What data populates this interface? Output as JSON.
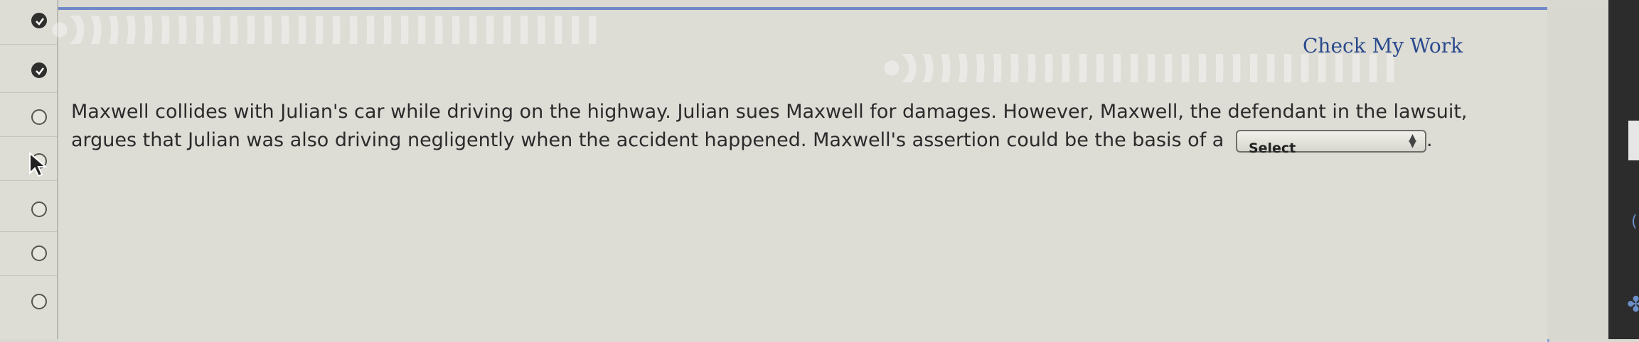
{
  "header": {
    "check_work_label": "Check My Work"
  },
  "question": {
    "text_line_1": "Maxwell collides with Julian's car while driving on the highway. Julian sues Maxwell for damages. However, Maxwell, the defendant in the lawsuit,",
    "text_line_2_before": "argues that Julian was also driving negligently when the accident happened. Maxwell's assertion could be the basis of a",
    "select_value": "Select",
    "text_after": "."
  },
  "nav": {
    "items": [
      {
        "status": "completed",
        "icon": "check-circle-icon"
      },
      {
        "status": "completed",
        "icon": "check-circle-icon"
      },
      {
        "status": "unanswered",
        "icon": "empty-circle-icon"
      },
      {
        "status": "current",
        "icon": "empty-circle-icon"
      },
      {
        "status": "unanswered",
        "icon": "empty-circle-icon"
      },
      {
        "status": "unanswered",
        "icon": "empty-circle-icon"
      },
      {
        "status": "unanswered",
        "icon": "empty-circle-icon"
      }
    ]
  },
  "colors": {
    "accent": "#6f88c7",
    "link": "#2a4a8c",
    "text": "#2b2b2b"
  }
}
